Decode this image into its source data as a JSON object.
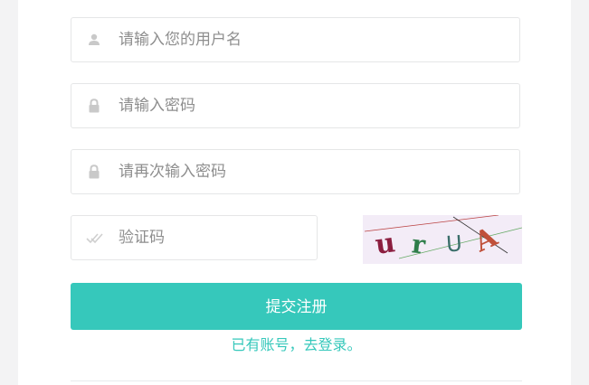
{
  "form": {
    "username_placeholder": "请输入您的用户名",
    "password_placeholder": "请输入密码",
    "confirm_password_placeholder": "请再次输入密码",
    "captcha_placeholder": "验证码",
    "captcha_chars": [
      "u",
      "r",
      "U",
      "A"
    ],
    "submit_label": "提交注册",
    "login_link": "已有账号，去登录。"
  },
  "icons": {
    "username": "user-icon",
    "password": "lock-icon",
    "confirm_password": "lock-icon",
    "captcha": "double-check-icon"
  },
  "colors": {
    "accent": "#36c8bb",
    "placeholder": "#8e8e8e",
    "border": "#e5e6e7",
    "background": "#f3f3f4",
    "captcha_bg": "#f3ecf7"
  }
}
